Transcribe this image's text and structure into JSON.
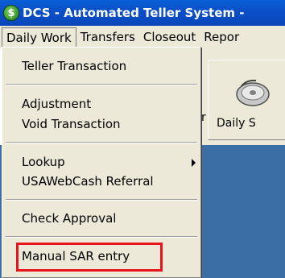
{
  "window": {
    "title": "DCS - Automated Teller System -",
    "icon_glyph": "$"
  },
  "menubar": {
    "items": [
      "Daily Work",
      "Transfers",
      "Closeout",
      "Repor"
    ]
  },
  "toolbar": {
    "partial_label_left": "r",
    "button_label": "Daily S"
  },
  "menu": {
    "items": [
      {
        "label": "Teller Transaction"
      },
      {
        "label": "Adjustment"
      },
      {
        "label": "Void Transaction"
      },
      {
        "label": "Lookup",
        "submenu": true
      },
      {
        "label": "USAWebCash Referral"
      },
      {
        "label": "Check Approval"
      },
      {
        "label": "Manual SAR entry",
        "highlighted": true
      }
    ]
  },
  "colors": {
    "title_bar": "#0b4fc7",
    "desktop": "#3a6ea5",
    "highlight_border": "#e8141c",
    "menu_bg": "#ece9d8"
  }
}
